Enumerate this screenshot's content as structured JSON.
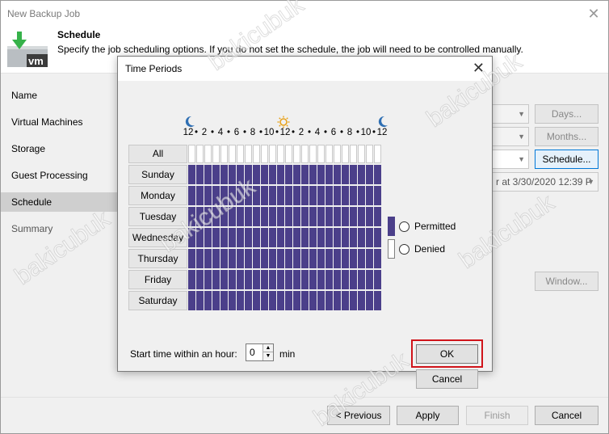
{
  "window": {
    "title": "New Backup Job"
  },
  "header": {
    "title": "Schedule",
    "description": "Specify the job scheduling options. If you do not set the schedule, the job will need to be controlled manually.",
    "logo_text": "vm"
  },
  "sidebar": {
    "items": [
      {
        "label": "Name"
      },
      {
        "label": "Virtual Machines"
      },
      {
        "label": "Storage"
      },
      {
        "label": "Guest Processing"
      },
      {
        "label": "Schedule",
        "active": true
      },
      {
        "label": "Summary"
      }
    ]
  },
  "background_controls": {
    "days_button": "Days...",
    "months_button": "Months...",
    "schedule_button": "Schedule...",
    "after_combo": "r at 3/30/2020 12:39 P",
    "window_button": "Window..."
  },
  "footer": {
    "previous": "< Previous",
    "apply": "Apply",
    "finish": "Finish",
    "cancel": "Cancel"
  },
  "dialog": {
    "title": "Time Periods",
    "all_label": "All",
    "hour_labels": [
      "12",
      "•",
      "2",
      "•",
      "4",
      "•",
      "6",
      "•",
      "8",
      "•",
      "10",
      "•",
      "12",
      "•",
      "2",
      "•",
      "4",
      "•",
      "6",
      "•",
      "8",
      "•",
      "10",
      "•",
      "12"
    ],
    "days": [
      "Sunday",
      "Monday",
      "Tuesday",
      "Wednesday",
      "Thursday",
      "Friday",
      "Saturday"
    ],
    "permitted_hours_per_day": 24,
    "legend": {
      "permitted": "Permitted",
      "denied": "Denied"
    },
    "start_label": "Start time within an hour:",
    "start_value": "0",
    "min_label": "min",
    "ok": "OK",
    "cancel": "Cancel",
    "colors": {
      "permitted": "#4b3f8a",
      "denied": "#ffffff",
      "highlight": "#d0141a"
    }
  },
  "watermark": {
    "text": "bakicubuk"
  }
}
